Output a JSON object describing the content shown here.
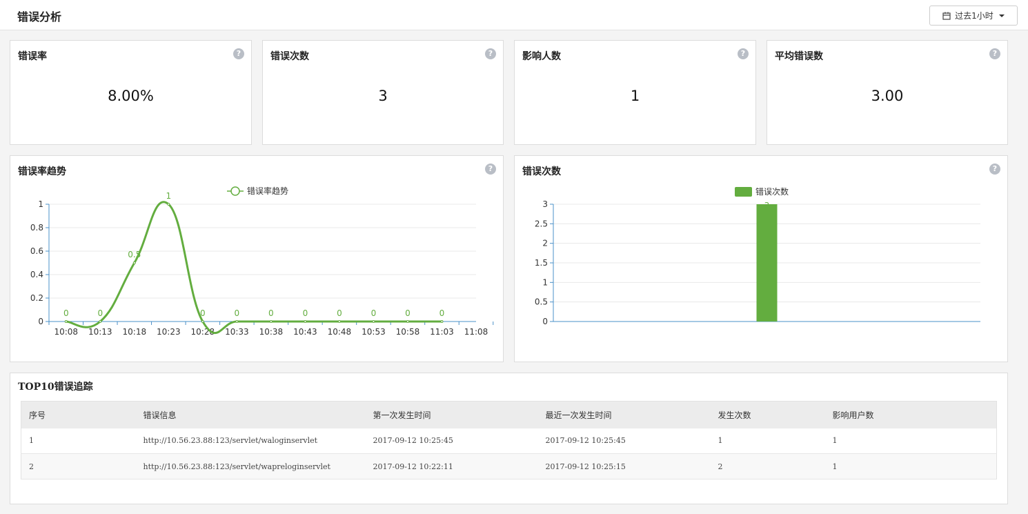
{
  "header": {
    "title": "错误分析",
    "range_label": "过去1小时"
  },
  "metrics": [
    {
      "title": "错误率",
      "value": "8.00%"
    },
    {
      "title": "错误次数",
      "value": "3"
    },
    {
      "title": "影响人数",
      "value": "1"
    },
    {
      "title": "平均错误数",
      "value": "3.00"
    }
  ],
  "help_glyph": "?",
  "trend_panel": {
    "title": "错误率趋势"
  },
  "count_panel": {
    "title": "错误次数"
  },
  "chart_data": [
    {
      "type": "line",
      "title": "",
      "legend": [
        "错误率趋势"
      ],
      "legend_position": "top",
      "x": [
        "10:08",
        "10:13",
        "10:18",
        "10:23",
        "10:28",
        "10:33",
        "10:38",
        "10:43",
        "10:48",
        "10:53",
        "10:58",
        "11:03",
        "11:08"
      ],
      "series": [
        {
          "name": "错误率趋势",
          "values": [
            0,
            0,
            0.5,
            1,
            0,
            0,
            0,
            0,
            0,
            0,
            0,
            0
          ],
          "data_labels": [
            "0",
            "0",
            "0.5",
            "1",
            "0",
            "0",
            "0",
            "0",
            "0",
            "0",
            "0",
            "0"
          ]
        }
      ],
      "y_ticks": [
        "0",
        "0.2",
        "0.4",
        "0.6",
        "0.8",
        "1"
      ],
      "ylim": [
        0,
        1
      ],
      "grid": true,
      "smooth": true,
      "color": "#63ad3f"
    },
    {
      "type": "bar",
      "title": "",
      "legend": [
        "错误次数"
      ],
      "legend_position": "top",
      "categories": [
        "",
        "",
        "",
        "",
        "",
        "",
        "",
        "",
        "",
        "",
        "",
        "",
        ""
      ],
      "series": [
        {
          "name": "错误次数",
          "values": [
            null,
            null,
            null,
            null,
            null,
            null,
            3,
            null,
            null,
            null,
            null,
            null,
            null
          ],
          "data_labels": [
            "",
            "",
            "",
            "",
            "",
            "",
            "3",
            "",
            "",
            "",
            "",
            "",
            ""
          ]
        }
      ],
      "y_ticks": [
        "0",
        "0.5",
        "1",
        "1.5",
        "2",
        "2.5",
        "3"
      ],
      "ylim": [
        0,
        3
      ],
      "grid": true,
      "color": "#63ad3f"
    }
  ],
  "table": {
    "title": "TOP10错误追踪",
    "columns": [
      "序号",
      "错误信息",
      "第一次发生时间",
      "最近一次发生时间",
      "发生次数",
      "影响用户数"
    ],
    "rows": [
      [
        "1",
        "http://10.56.23.88:123/servlet/waloginservlet",
        "2017-09-12 10:25:45",
        "2017-09-12 10:25:45",
        "1",
        "1"
      ],
      [
        "2",
        "http://10.56.23.88:123/servlet/wapreloginservlet",
        "2017-09-12 10:22:11",
        "2017-09-12 10:25:15",
        "2",
        "1"
      ]
    ]
  },
  "colors": {
    "accent": "#63ad3f",
    "axis": "#4a90c8",
    "grid": "#e8e8e8"
  }
}
